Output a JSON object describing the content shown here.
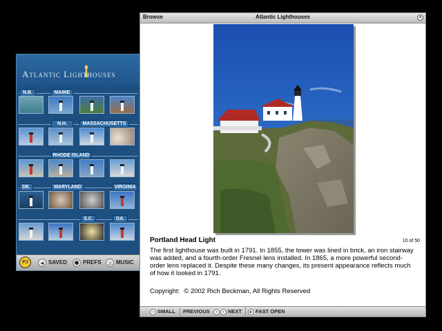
{
  "left_panel": {
    "title": "Atlantic Lighthouses",
    "regions": [
      "N.B.",
      "Maine",
      "N.H.",
      "Massachusetts",
      "Rhode Island",
      "DE.",
      "Maryland",
      "Virginia",
      "S.C.",
      "GA."
    ],
    "toolbar": {
      "logo": "PJ",
      "saved": "SAVED",
      "prefs": "PREFS",
      "music": "MUSIC"
    }
  },
  "browse": {
    "window_label": "Browse",
    "window_title": "Atlantic Lighthouses",
    "close_glyph": "×",
    "photo_title": "Portland Head Light",
    "counter": "10 of 50",
    "description": "The first lighthouse was built in 1791. In 1855, the tower was lined in brick, an iron stairway was added, and a fourth-order Fresnel lens installed. In 1865, a more powerful second-order lens replaced it. Despite these many changes, its present appearance reflects much of how it looked in 1791.",
    "copyright_label": "Copyright:",
    "copyright_text": "© 2002 Rich Beckman, All Rights Reserved",
    "toolbar": {
      "small": "SMALL",
      "previous": "PREVIOUS",
      "next": "NEXT",
      "fast_open": "FAST OPEN"
    }
  },
  "icons": {
    "close": "close-icon",
    "small": "small-icon",
    "previous": "chevron-left-icon",
    "next": "chevron-right-icon",
    "fast_open": "fast-open-icon",
    "saved": "back-icon",
    "prefs": "gear-icon",
    "music": "music-icon"
  },
  "colors": {
    "panel_blue": "#1d4f80",
    "sky_blue": "#1f5cb8",
    "roof_red": "#b02a25"
  }
}
